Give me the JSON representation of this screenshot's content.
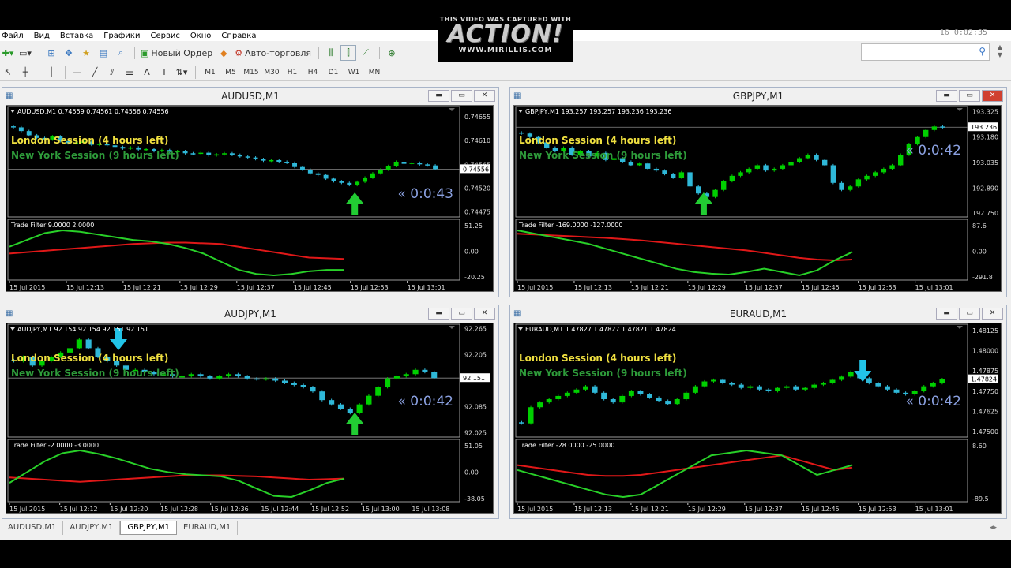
{
  "menu": [
    "Файл",
    "Вид",
    "Вставка",
    "Графики",
    "Сервис",
    "Окно",
    "Справка"
  ],
  "toolbar": {
    "new_order": "Новый Ордер",
    "autotrade": "Авто-торговля",
    "timeframes": [
      "M1",
      "M5",
      "M15",
      "M30",
      "H1",
      "H4",
      "D1",
      "W1",
      "MN"
    ]
  },
  "recorder_clock": "16  0:02:35",
  "logo": {
    "line1": "THIS VIDEO WAS CAPTURED WITH",
    "line2": "ACTION!",
    "line3": "WWW.MIRILLIS.COM"
  },
  "session_labels": {
    "london": "London Session (4 hours left)",
    "newyork": "New York Session (9 hours left)"
  },
  "indicator_name": "Trade Filter",
  "tabs": [
    "AUDUSD,M1",
    "AUDJPY,M1",
    "GBPJPY,M1",
    "EURAUD,M1"
  ],
  "active_tab": 2,
  "colors": {
    "bull": "#00d000",
    "bear": "#2fb8d8",
    "arrow_up": "#22cc33",
    "arrow_down": "#22c4e8",
    "timer": "#8aa0e0",
    "london": "#f0e040",
    "newyork": "#2e9b3a",
    "red_line": "#e01818",
    "green_line": "#28d028"
  },
  "windows": [
    {
      "id": "audusd",
      "title": "AUDUSD,M1",
      "header": "AUDUSD,M1  0.74559 0.74561 0.74556 0.74556",
      "timer": "« 0:0:43",
      "price_ticks": [
        "0.74655",
        "0.74610",
        "0.74565",
        "0.74556",
        "0.74520",
        "0.74475"
      ],
      "current_price": "0.74556",
      "ind_header": "Trade Filter 9.0000 2.0000",
      "ind_ticks": [
        "51.25",
        "0.00",
        "-20.25"
      ],
      "time_labels": [
        "15 Jul 2015",
        "15 Jul 12:13",
        "15 Jul 12:21",
        "15 Jul 12:29",
        "15 Jul 12:37",
        "15 Jul 12:45",
        "15 Jul 12:53",
        "15 Jul 13:01"
      ],
      "arrows": [
        {
          "dir": "up",
          "at": 0.8
        }
      ],
      "chart_data": {
        "type": "candlestick",
        "y_range": [
          0.7447,
          0.7467
        ],
        "closes": [
          0.74635,
          0.74628,
          0.7462,
          0.74615,
          0.74612,
          0.74618,
          0.74609,
          0.74605,
          0.74606,
          0.74608,
          0.74602,
          0.74604,
          0.74601,
          0.74598,
          0.74595,
          0.74597,
          0.74593,
          0.74594,
          0.7459,
          0.74592,
          0.74588,
          0.7459,
          0.74586,
          0.74585,
          0.74587,
          0.74582,
          0.74584,
          0.74586,
          0.74583,
          0.7458,
          0.74578,
          0.74575,
          0.74572,
          0.74573,
          0.7457,
          0.74568,
          0.7456,
          0.74555,
          0.74548,
          0.74545,
          0.74538,
          0.74533,
          0.7453,
          0.74526,
          0.74532,
          0.7454,
          0.74548,
          0.74555,
          0.74562,
          0.7457,
          0.74566,
          0.74568,
          0.74565,
          0.74563,
          0.74556
        ],
        "red": [
          10,
          12,
          14,
          16,
          18,
          20,
          22,
          24,
          25,
          26,
          26,
          25,
          24,
          20,
          16,
          12,
          8,
          4,
          3,
          2
        ],
        "green": [
          20,
          30,
          40,
          44,
          42,
          38,
          34,
          30,
          28,
          24,
          18,
          10,
          -2,
          -14,
          -20,
          -22,
          -20,
          -16,
          -14,
          -14
        ]
      }
    },
    {
      "id": "gbpjpy",
      "title": "GBPJPY,M1",
      "header": "GBPJPY,M1  193.257 193.257 193.236 193.236",
      "timer": "« 0:0:42",
      "price_ticks": [
        "193.325",
        "193.236",
        "193.180",
        "193.035",
        "192.890",
        "192.750"
      ],
      "current_price": "193.236",
      "ind_header": "Trade Filter -169.0000 -127.0000",
      "ind_ticks": [
        "87.6",
        "0.00",
        "-291.8"
      ],
      "time_labels": [
        "15 Jul 2015",
        "15 Jul 12:13",
        "15 Jul 12:21",
        "15 Jul 12:29",
        "15 Jul 12:37",
        "15 Jul 12:45",
        "15 Jul 12:53",
        "15 Jul 13:01"
      ],
      "arrows": [
        {
          "dir": "up",
          "at": 0.43
        }
      ],
      "chart_data": {
        "type": "candlestick",
        "y_range": [
          192.74,
          193.34
        ],
        "closes": [
          193.2,
          193.18,
          193.15,
          193.12,
          193.1,
          193.12,
          193.08,
          193.1,
          193.07,
          193.09,
          193.05,
          193.06,
          193.04,
          193.02,
          193.03,
          193.0,
          192.99,
          192.97,
          192.95,
          192.98,
          192.9,
          192.86,
          192.84,
          192.88,
          192.93,
          192.96,
          192.98,
          193.0,
          193.02,
          192.99,
          193.0,
          193.02,
          193.04,
          193.06,
          193.08,
          193.05,
          193.02,
          192.92,
          192.88,
          192.9,
          192.94,
          192.96,
          192.98,
          193.0,
          193.02,
          193.08,
          193.14,
          193.18,
          193.22,
          193.24,
          193.236
        ],
        "red": [
          60,
          55,
          50,
          45,
          40,
          35,
          28,
          20,
          10,
          0,
          -10,
          -20,
          -30,
          -40,
          -55,
          -70,
          -85,
          -95,
          -100,
          -95
        ],
        "green": [
          80,
          60,
          40,
          20,
          0,
          -30,
          -60,
          -90,
          -120,
          -150,
          -170,
          -180,
          -185,
          -170,
          -150,
          -170,
          -190,
          -160,
          -100,
          -50
        ]
      }
    },
    {
      "id": "audjpy",
      "title": "AUDJPY,M1",
      "header": "AUDJPY,M1  92.154 92.154 92.151 92.151",
      "timer": "« 0:0:42",
      "price_ticks": [
        "92.265",
        "92.205",
        "92.151",
        "92.085",
        "92.025"
      ],
      "current_price": "92.151",
      "ind_header": "Trade Filter -2.0000 -3.0000",
      "ind_ticks": [
        "51.05",
        "0.00",
        "-38.05"
      ],
      "time_labels": [
        "15 Jul 2015",
        "15 Jul 12:12",
        "15 Jul 12:20",
        "15 Jul 12:28",
        "15 Jul 12:36",
        "15 Jul 12:44",
        "15 Jul 12:52",
        "15 Jul 13:00",
        "15 Jul 13:08"
      ],
      "arrows": [
        {
          "dir": "down",
          "at": 0.25
        },
        {
          "dir": "up",
          "at": 0.8
        }
      ],
      "chart_data": {
        "type": "candlestick",
        "y_range": [
          92.02,
          92.27
        ],
        "closes": [
          92.19,
          92.2,
          92.18,
          92.19,
          92.2,
          92.21,
          92.22,
          92.24,
          92.22,
          92.2,
          92.19,
          92.18,
          92.17,
          92.17,
          92.165,
          92.16,
          92.16,
          92.155,
          92.155,
          92.16,
          92.155,
          92.15,
          92.155,
          92.16,
          92.155,
          92.15,
          92.148,
          92.15,
          92.145,
          92.14,
          92.135,
          92.13,
          92.12,
          92.1,
          92.09,
          92.08,
          92.07,
          92.09,
          92.11,
          92.13,
          92.15,
          92.155,
          92.16,
          92.17,
          92.165,
          92.151
        ],
        "red": [
          0,
          -2,
          -4,
          -6,
          -8,
          -6,
          -4,
          -2,
          0,
          2,
          4,
          4,
          4,
          3,
          2,
          0,
          -2,
          -4,
          -3,
          -2
        ],
        "green": [
          -10,
          10,
          30,
          45,
          50,
          44,
          36,
          26,
          16,
          10,
          6,
          4,
          2,
          -6,
          -20,
          -34,
          -36,
          -24,
          -10,
          -2
        ]
      }
    },
    {
      "id": "euraud",
      "title": "EURAUD,M1",
      "header": "EURAUD,M1  1.47827 1.47827 1.47821 1.47824",
      "timer": "« 0:0:42",
      "price_ticks": [
        "1.48125",
        "1.48000",
        "1.47875",
        "1.47824",
        "1.47750",
        "1.47625",
        "1.47500"
      ],
      "current_price": "1.47824",
      "ind_header": "Trade Filter -28.0000 -25.0000",
      "ind_ticks": [
        "8.60",
        "-89.5"
      ],
      "time_labels": [
        "15 Jul 2015",
        "15 Jul 12:13",
        "15 Jul 12:21",
        "15 Jul 12:29",
        "15 Jul 12:37",
        "15 Jul 12:45",
        "15 Jul 12:53",
        "15 Jul 13:01"
      ],
      "arrows": [
        {
          "dir": "down",
          "at": 0.8
        }
      ],
      "chart_data": {
        "type": "candlestick",
        "y_range": [
          1.4748,
          1.4815
        ],
        "closes": [
          1.4755,
          1.4765,
          1.4768,
          1.477,
          1.4772,
          1.4774,
          1.4776,
          1.4778,
          1.4774,
          1.477,
          1.4768,
          1.4772,
          1.4775,
          1.4773,
          1.4771,
          1.4769,
          1.4767,
          1.477,
          1.4774,
          1.4778,
          1.4781,
          1.4782,
          1.478,
          1.4779,
          1.4777,
          1.4778,
          1.4776,
          1.4775,
          1.4777,
          1.4778,
          1.4776,
          1.4777,
          1.4779,
          1.478,
          1.4782,
          1.4784,
          1.4787,
          1.4783,
          1.478,
          1.4778,
          1.4776,
          1.4774,
          1.4773,
          1.4775,
          1.4778,
          1.478,
          1.47824
        ],
        "red": [
          -20,
          -25,
          -30,
          -35,
          -40,
          -42,
          -42,
          -40,
          -35,
          -30,
          -25,
          -20,
          -15,
          -10,
          -5,
          0,
          -10,
          -20,
          -30,
          -25
        ],
        "green": [
          -30,
          -40,
          -50,
          -60,
          -70,
          -80,
          -85,
          -80,
          -60,
          -40,
          -20,
          0,
          5,
          10,
          5,
          0,
          -20,
          -40,
          -30,
          -20
        ]
      }
    }
  ]
}
